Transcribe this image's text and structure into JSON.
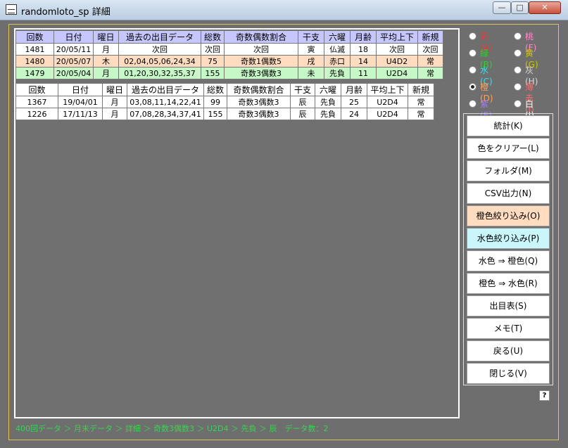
{
  "window": {
    "title": "randomloto_sp  詳細",
    "min": "—",
    "max": "□",
    "close": "✕"
  },
  "top_table": {
    "headers": [
      "回数",
      "日付",
      "曜日",
      "過去の出目データ",
      "総数",
      "奇数偶数割合",
      "干支",
      "六曜",
      "月齢",
      "平均上下",
      "新規"
    ],
    "rows": [
      [
        "1481",
        "20/05/11",
        "月",
        "次回",
        "次回",
        "次回",
        "寅",
        "仏滅",
        "18",
        "次回",
        "次回"
      ],
      [
        "1480",
        "20/05/07",
        "木",
        "02,04,05,06,24,34",
        "75",
        "奇数1偶数5",
        "戌",
        "赤口",
        "14",
        "U4D2",
        "常"
      ],
      [
        "1479",
        "20/05/04",
        "月",
        "01,20,30,32,35,37",
        "155",
        "奇数3偶数3",
        "未",
        "先負",
        "11",
        "U2D4",
        "常"
      ]
    ]
  },
  "bottom_table": {
    "headers": [
      "回数",
      "日付",
      "曜日",
      "過去の出目データ",
      "総数",
      "奇数偶数割合",
      "干支",
      "六曜",
      "月齢",
      "平均上下",
      "新規"
    ],
    "rows": [
      [
        "1367",
        "19/04/01",
        "月",
        "03,08,11,14,22,41",
        "99",
        "奇数3偶数3",
        "辰",
        "先負",
        "25",
        "U2D4",
        "常"
      ],
      [
        "1226",
        "17/11/13",
        "月",
        "07,08,28,34,37,41",
        "155",
        "奇数3偶数3",
        "辰",
        "先負",
        "24",
        "U2D4",
        "常"
      ]
    ]
  },
  "colors": {
    "items": [
      {
        "label": "赤(A)",
        "color": "#ff3030",
        "selected": false
      },
      {
        "label": "桃(F)",
        "color": "#ff88cc",
        "selected": false
      },
      {
        "label": "緑(B)",
        "color": "#33cc33",
        "selected": false
      },
      {
        "label": "黄(G)",
        "color": "#d4c400",
        "selected": false
      },
      {
        "label": "水(C)",
        "color": "#33e0f0",
        "selected": false
      },
      {
        "label": "灰(H)",
        "color": "#d8d8d8",
        "selected": false
      },
      {
        "label": "橙(D)",
        "color": "#ffa060",
        "selected": true
      },
      {
        "label": "薄赤(I)",
        "color": "#ff6a6a",
        "selected": false
      },
      {
        "label": "紫(E)",
        "color": "#a07cff",
        "selected": false
      },
      {
        "label": "白(J)",
        "color": "#ffffff",
        "selected": false
      }
    ]
  },
  "buttons": {
    "stats": "統計(K)",
    "clear_color": "色をクリアー(L)",
    "folder": "フォルダ(M)",
    "csv": "CSV出力(N)",
    "orange_filter": "橙色絞り込み(O)",
    "cyan_filter": "水色絞り込み(P)",
    "cyan_to_orange": "水色 ⇒ 橙色(Q)",
    "orange_to_cyan": "橙色 ⇒ 水色(R)",
    "outcome_table": "出目表(S)",
    "memo": "メモ(T)",
    "back": "戻る(U)",
    "close": "閉じる(V)",
    "help": "?"
  },
  "status_bar": "400回データ ＞ 月末データ ＞ 詳細 ＞ 奇数3偶数3 ＞ U2D4 ＞ 先負 ＞ 辰　データ数：2"
}
